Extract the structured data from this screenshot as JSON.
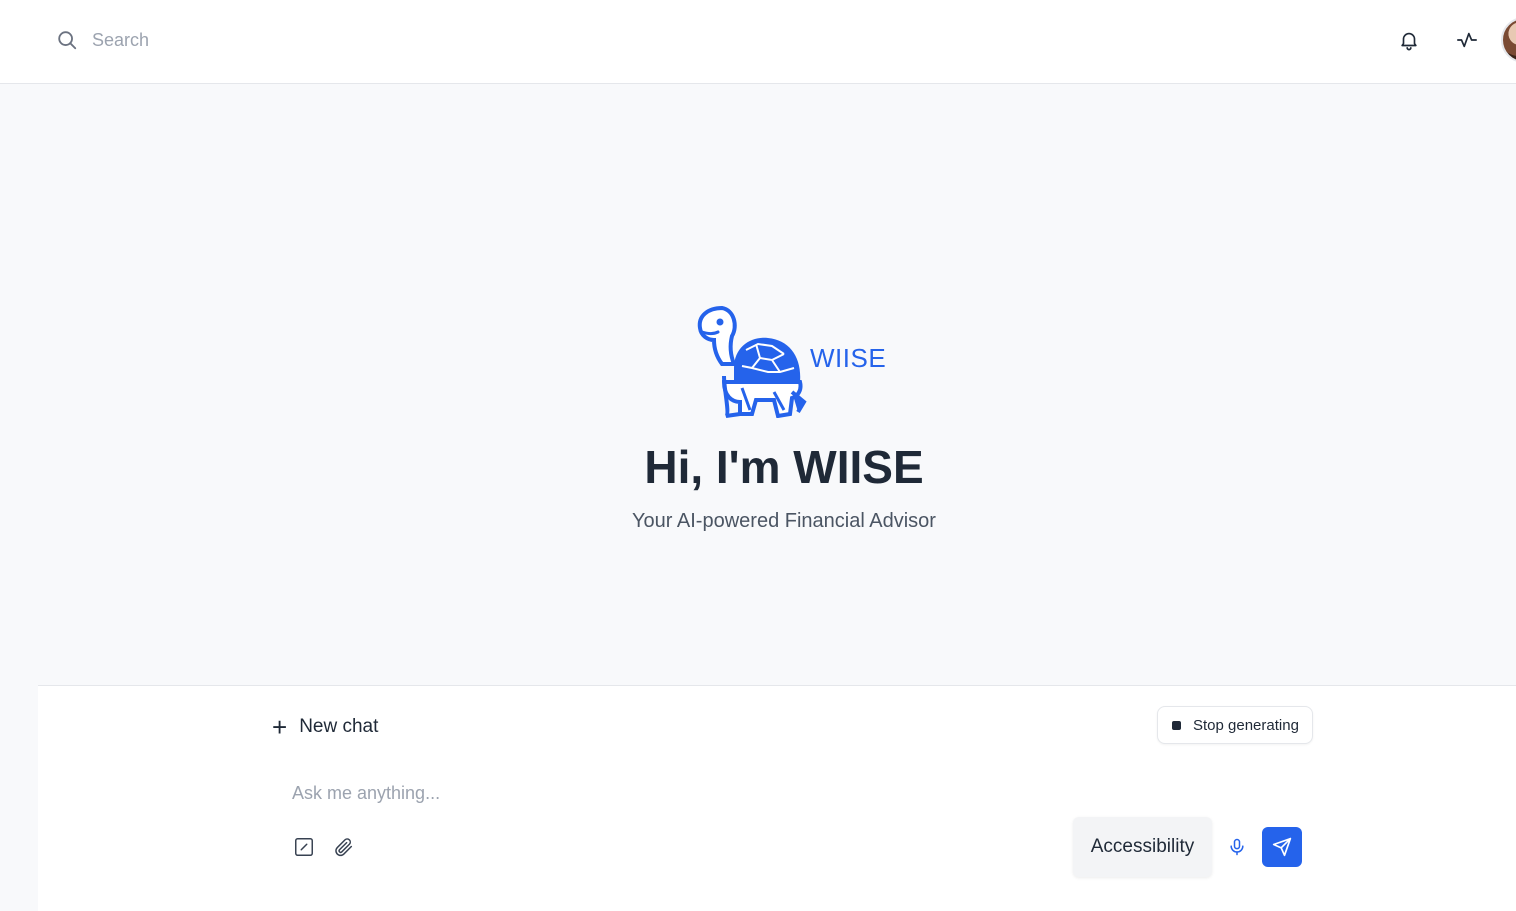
{
  "header": {
    "search_placeholder": "Search",
    "icons": [
      "search-icon",
      "bell-icon",
      "activity-icon",
      "avatar"
    ]
  },
  "hero": {
    "logo_text": "WIISE",
    "title": "Hi, I'm WIISE",
    "subtitle": "Your AI-powered Financial Advisor"
  },
  "composer": {
    "new_chat_label": "New chat",
    "stop_label": "Stop generating",
    "input_placeholder": "Ask me anything...",
    "accessibility_label": "Accessibility",
    "tools": [
      "edit-icon",
      "paperclip-icon",
      "mic-icon",
      "send-icon"
    ]
  },
  "colors": {
    "brand": "#2563eb",
    "text": "#1f2937",
    "muted": "#9ca3af",
    "background": "#f8f9fb"
  }
}
